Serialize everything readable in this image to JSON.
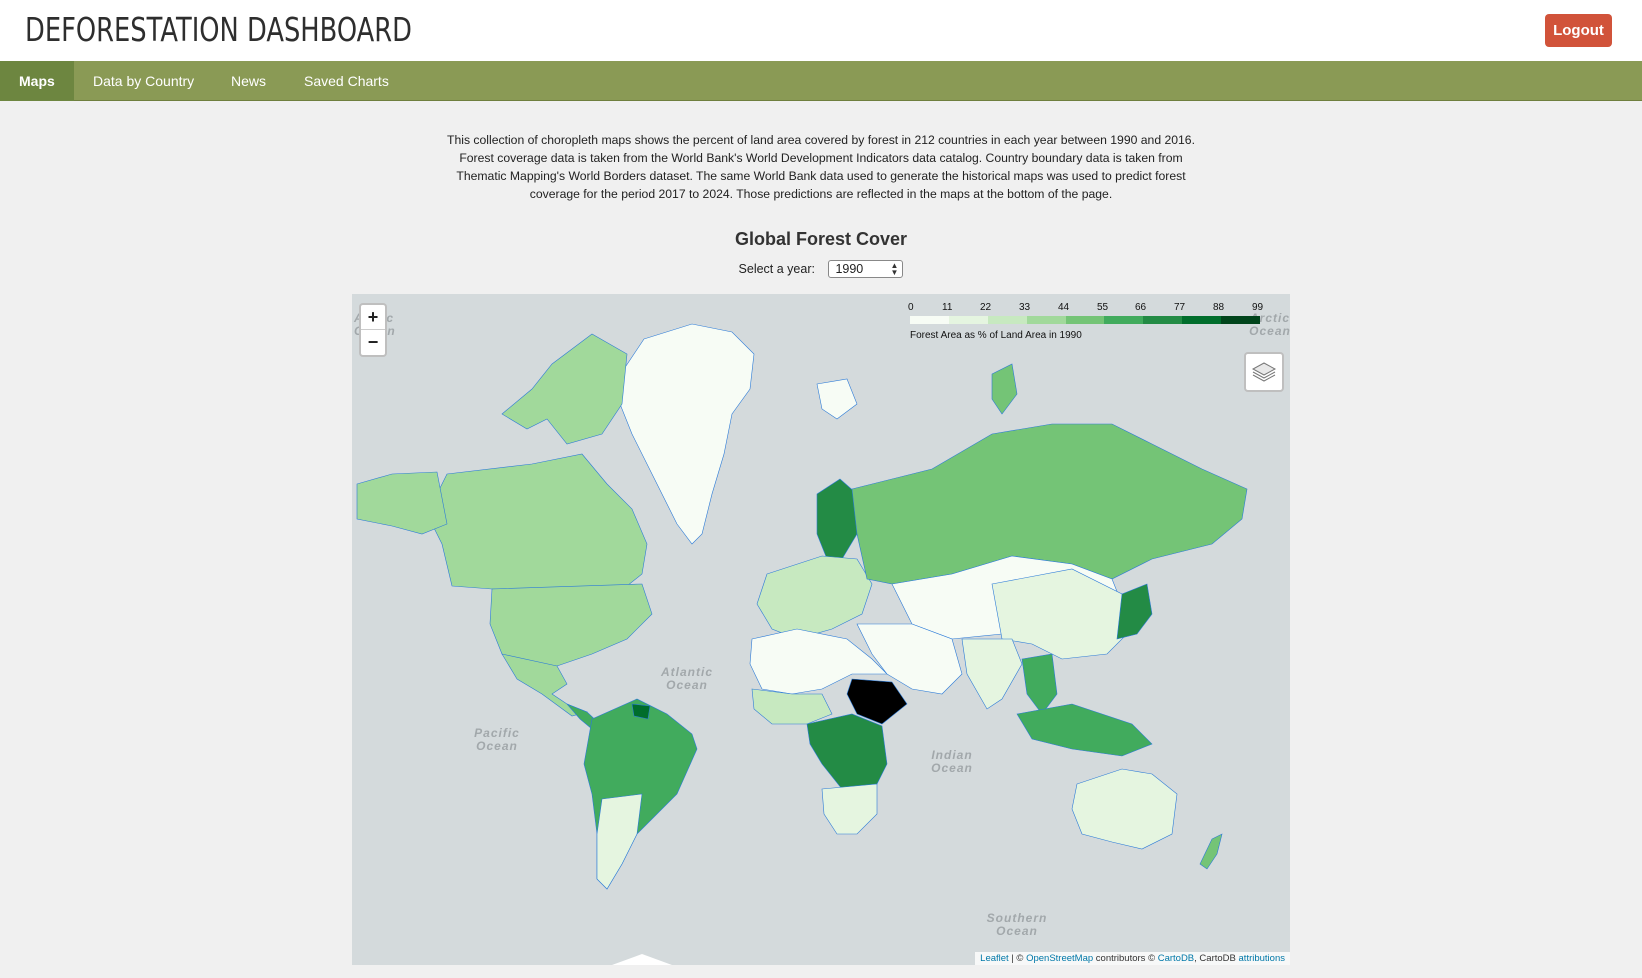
{
  "header": {
    "title": "DEFORESTATION DASHBOARD",
    "logout_label": "Logout"
  },
  "nav": {
    "items": [
      {
        "label": "Maps",
        "active": true
      },
      {
        "label": "Data by Country",
        "active": false
      },
      {
        "label": "News",
        "active": false
      },
      {
        "label": "Saved Charts",
        "active": false
      }
    ]
  },
  "intro": "This collection of choropleth maps shows the percent of land area covered by forest in 212 countries in each year between 1990 and 2016. Forest coverage data is taken from the World Bank's World Development Indicators data catalog. Country boundary data is taken from Thematic Mapping's World Borders dataset. The same World Bank data used to generate the historical maps was used to predict forest coverage for the period 2017 to 2024. Those predictions are reflected in the maps at the bottom of the page.",
  "map": {
    "title": "Global Forest Cover",
    "year_label": "Select a year:",
    "year_value": "1990",
    "zoom_in": "+",
    "zoom_out": "−",
    "legend": {
      "ticks": [
        "0",
        "11",
        "22",
        "33",
        "44",
        "55",
        "66",
        "77",
        "88",
        "99"
      ],
      "colors": [
        "#f7fcf5",
        "#e5f5e0",
        "#c7e9c0",
        "#a1d99b",
        "#74c476",
        "#41ab5d",
        "#238b45",
        "#006d2c",
        "#00441b"
      ],
      "caption": "Forest Area as % of Land Area in 1990"
    },
    "ocean_labels": {
      "arctic_left": "Arctic Ocean",
      "arctic_right": "Arctic Ocean",
      "atlantic": "Atlantic Ocean",
      "pacific": "Pacific Ocean",
      "indian": "Indian Ocean",
      "southern": "Southern Ocean"
    },
    "attribution": {
      "leaflet": "Leaflet",
      "sep1": " | © ",
      "osm": "OpenStreetMap",
      "contrib": " contributors © ",
      "cartodb": "CartoDB",
      "sep2": ", CartoDB ",
      "attributions": "attributions"
    }
  }
}
